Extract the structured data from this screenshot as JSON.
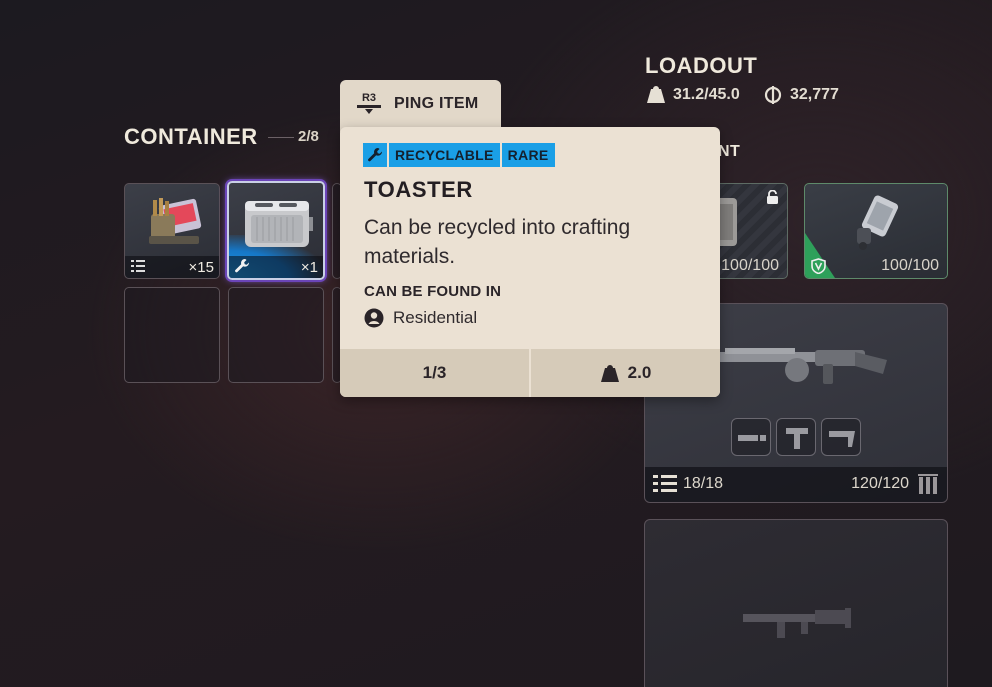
{
  "container": {
    "title": "CONTAINER",
    "count": "2/8",
    "slots": [
      {
        "quantity": "×15",
        "corner_icon": "list-icon"
      },
      {
        "quantity": "×1",
        "corner_icon": "wrench-icon",
        "selected": true
      }
    ]
  },
  "ping": {
    "button_glyph": "R3",
    "label": "PING ITEM"
  },
  "tooltip": {
    "tags": [
      "RECYCLABLE",
      "RARE"
    ],
    "name": "TOASTER",
    "description": "Can be recycled into crafting materials.",
    "found_in_label": "CAN BE FOUND IN",
    "location": "Residential",
    "stack": "1/3",
    "weight": "2.0",
    "colors": {
      "rarity": "#1a9fe6",
      "background": "#ebe1d3"
    }
  },
  "loadout": {
    "title": "LOADOUT",
    "weight": "31.2/45.0",
    "credits": "32,777",
    "section_partial_label": "NT",
    "gear": [
      {
        "durability": "100/100",
        "locked": true
      },
      {
        "durability": "100/100",
        "icon": "shield-icon"
      }
    ],
    "weapon": {
      "magazine": "18/18",
      "reserve": "120/120"
    }
  }
}
